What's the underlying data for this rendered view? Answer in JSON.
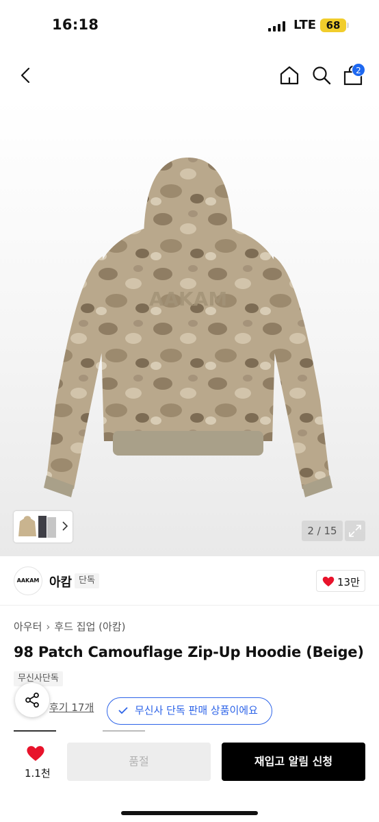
{
  "status_bar": {
    "time": "16:18",
    "network": "LTE",
    "battery": "68"
  },
  "nav": {
    "back_icon": "chevron-left-icon",
    "home_icon": "home-icon",
    "search_icon": "search-icon",
    "bag_icon": "shopping-bag-icon",
    "bag_count": "2"
  },
  "gallery": {
    "pager": "2 / 15",
    "hoodie_logo_text": "AAKAM",
    "expand_icon": "expand-icon"
  },
  "brand": {
    "logo_text": "AAKAM",
    "name": "아캄",
    "tag": "단독",
    "likes": "13만"
  },
  "product": {
    "breadcrumb": [
      "아우터",
      "후드 집업 (아캄)"
    ],
    "title": "98 Patch Camouflage Zip-Up Hoodie (Beige)",
    "exclusive_tag": "무신사단독",
    "reviews": "후기 17개",
    "exclusive_badge": "무신사 단독 판매 상품이에요"
  },
  "bottom_bar": {
    "wish_count": "1.1천",
    "soldout_label": "품절",
    "restock_label": "재입고 알림 신청"
  },
  "colors": {
    "accent_blue": "#2c63e8",
    "badge_blue": "#1e68f0",
    "heart_red": "#e8132b",
    "battery_yellow": "#f1cd2c",
    "hoodie_beige": "#b9a88c"
  }
}
